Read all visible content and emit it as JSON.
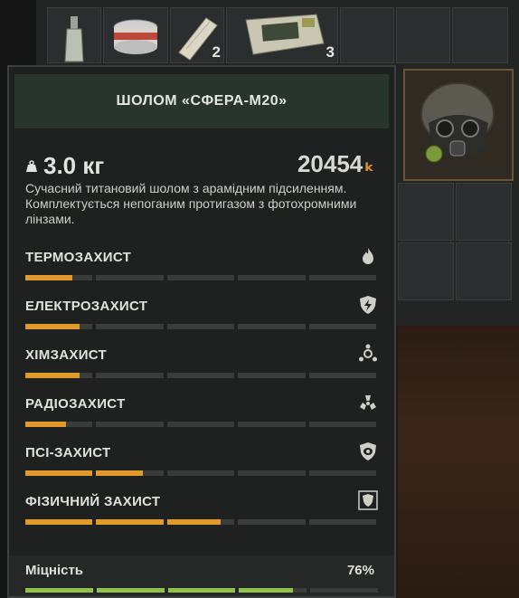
{
  "inventory": {
    "items": [
      {
        "name": "bottle",
        "count": ""
      },
      {
        "name": "canned-food",
        "count": ""
      },
      {
        "name": "bandage",
        "count": "2"
      },
      {
        "name": "ammo-box",
        "count": "3"
      }
    ]
  },
  "item": {
    "title": "ШОЛОМ «СФЕРА-М20»",
    "weight": "3.0 кг",
    "price": "20454",
    "currency_icon": "ₖ",
    "description": "Сучасний титановий шолом з арамідним підсиленням. Комплектується непоганим протигазом з фотохромними лінзами."
  },
  "stats": [
    {
      "label": "ТЕРМОЗАХИСТ",
      "icon": "fire-icon",
      "level": 0.7
    },
    {
      "label": "ЕЛЕКТРОЗАХИСТ",
      "icon": "lightning-shield-icon",
      "level": 0.8
    },
    {
      "label": "ХІМЗАХИСТ",
      "icon": "chemical-icon",
      "level": 0.8
    },
    {
      "label": "РАДІОЗАХИСТ",
      "icon": "radiation-icon",
      "level": 0.6
    },
    {
      "label": "ПСІ-ЗАХИСТ",
      "icon": "psi-icon",
      "level": 1.7
    },
    {
      "label": "ФІЗИЧНИЙ ЗАХИСТ",
      "icon": "armor-icon",
      "level": 2.8
    }
  ],
  "durability": {
    "label": "Міцність",
    "value": "76%",
    "level": 0.76
  },
  "colors": {
    "accent": "#e09a2a",
    "durability": "#8fc24a",
    "header": "#27352d"
  }
}
